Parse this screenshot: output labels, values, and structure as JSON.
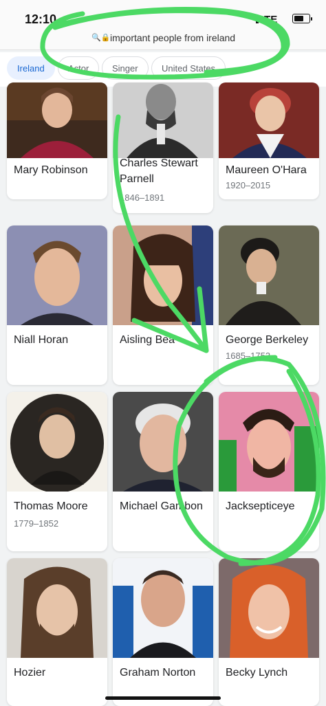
{
  "status": {
    "time": "12:10",
    "network": "LTE"
  },
  "urlbar": {
    "query": "important people from ireland"
  },
  "chips": [
    "Ireland",
    "Actor",
    "Singer",
    "United States"
  ],
  "people": [
    {
      "name": "Mary Robinson",
      "years": ""
    },
    {
      "name": "Charles Stewart Parnell",
      "years": "1846–1891"
    },
    {
      "name": "Maureen O'Hara",
      "years": "1920–2015"
    },
    {
      "name": "Niall Horan",
      "years": ""
    },
    {
      "name": "Aisling Bea",
      "years": ""
    },
    {
      "name": "George Berkeley",
      "years": "1685–1753"
    },
    {
      "name": "Thomas Moore",
      "years": "1779–1852"
    },
    {
      "name": "Michael Gambon",
      "years": ""
    },
    {
      "name": "Jacksepticeye",
      "years": ""
    },
    {
      "name": "Hozier",
      "years": ""
    },
    {
      "name": "Graham Norton",
      "years": ""
    },
    {
      "name": "Becky Lynch",
      "years": ""
    }
  ],
  "annotation_color": "#4cd964"
}
